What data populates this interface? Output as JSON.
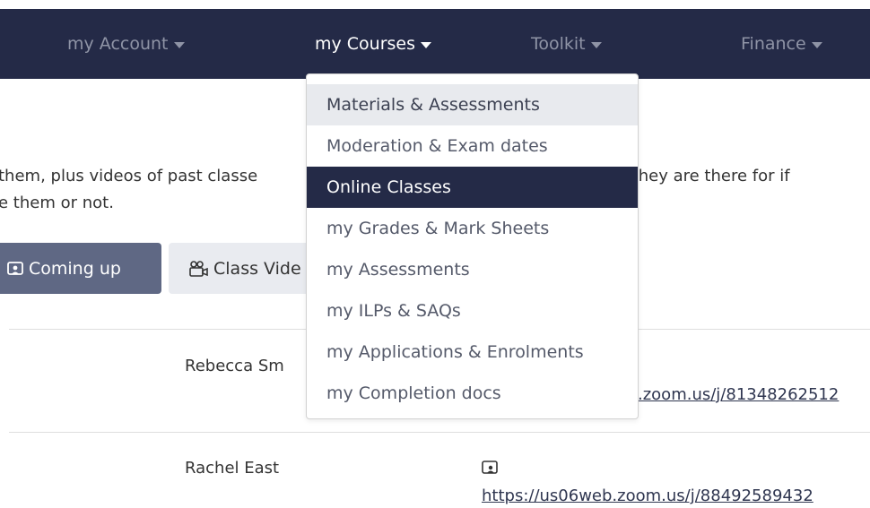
{
  "nav": {
    "items": [
      {
        "label": "my Account"
      },
      {
        "label": "my Courses"
      },
      {
        "label": "Toolkit"
      },
      {
        "label": "Finance"
      }
    ]
  },
  "dropdown": {
    "items": [
      {
        "label": "Materials & Assessments"
      },
      {
        "label": "Moderation & Exam dates"
      },
      {
        "label": "Online Classes"
      },
      {
        "label": "my Grades & Mark Sheets"
      },
      {
        "label": "my Assessments"
      },
      {
        "label": "my ILPs & SAQs"
      },
      {
        "label": "my Applications & Enrolments"
      },
      {
        "label": "my Completion docs"
      }
    ]
  },
  "intro": {
    "line1_a": "them, plus videos of past classe",
    "line1_b": "ory, they are there for if",
    "line2": "e them or not."
  },
  "buttons": {
    "coming_up": "Coming up",
    "class_videos": "Class Vide"
  },
  "rows": [
    {
      "name": "Rebecca Sm",
      "link": ".zoom.us/j/81348262512"
    },
    {
      "name": "Rachel East",
      "link": "https://us06web.zoom.us/j/88492589432"
    }
  ],
  "colors": {
    "navbar": "#242a47",
    "selected_item": "#242a47",
    "coming_up_button": "#5f6884"
  }
}
